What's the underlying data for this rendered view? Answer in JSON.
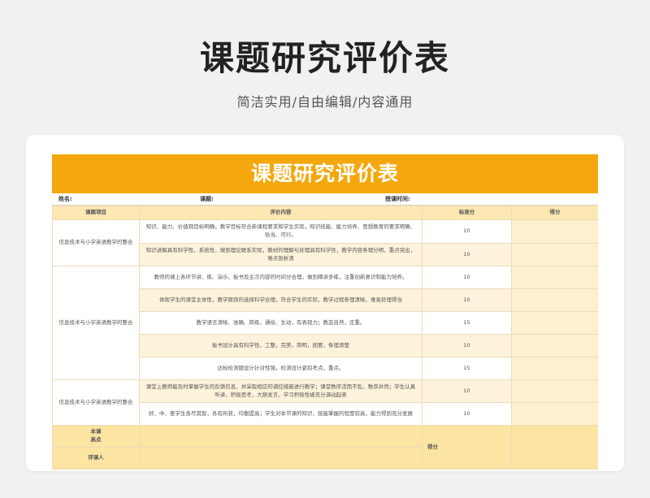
{
  "page": {
    "title": "课题研究评价表",
    "subtitle": "简洁实用/自由编辑/内容通用"
  },
  "sheet": {
    "banner": "课题研究评价表",
    "info": {
      "name_label": "姓名:",
      "topic_label": "课题:",
      "time_label": "授课时间:"
    },
    "headers": {
      "project": "课题项目",
      "content": "评价内容",
      "standard": "标准分",
      "score": "得分"
    },
    "groups": [
      {
        "project": "信息技术与小学英语教学的整合",
        "rows": [
          {
            "content": "知识、能力、价值观目标明确，教学目标符合新课程要求和学生实际，知识技能、能力培养、思想教育的要求明确、恰当、可行。",
            "standard": "10"
          },
          {
            "content": "知识讲解具有科学性，系统性，做到理论联系实际，教材的理解与处理具有科学性，教学内容条理分明，重点突出，难点剖析清",
            "standard": "10"
          }
        ]
      },
      {
        "project": "信息技术与小学英语教学的整合",
        "rows": [
          {
            "content": "教师的课上各环节讲、练、演示、板书及主次内容的时间分合理，做到精讲多练，注重创新意识和能力培养。",
            "standard": "10"
          },
          {
            "content": "体现学生的课堂主体性，教学原则的选择科学合理，符合学生的实际，教学过程条理清晰，难易处理得当",
            "standard": "10"
          },
          {
            "content": "教学语言清晰、准确、简练、通俗、生动，有表现力；教态自然，庄重。",
            "standard": "15"
          },
          {
            "content": "板书设计具有科学性，工整，完美，简明，扼要，条理清楚",
            "standard": "10"
          },
          {
            "content": "达标检测题设计针对性强，检测设计紧扣考点，重点。",
            "standard": "15"
          }
        ]
      },
      {
        "project": "信息技术与小学英语教学的整合",
        "rows": [
          {
            "content": "课堂上教师能及时掌握学生的反馈信息，并采取相应的调控措施进行教学；课堂秩序活而不乱，秩序井然；学生认真听讲，积极思考，大胆发言，学习积极性被充分调动起来",
            "standard": "10"
          },
          {
            "content": "好、中、差学生各尽其智，各有所获，均衡提高；学生对本节课的知识、技能掌握的程度较高，能力得到充分发展",
            "standard": "10"
          }
        ]
      }
    ],
    "footer": {
      "highlight_label": "本课\n高点",
      "reviewer_label": "评课人",
      "score_label": "得分"
    }
  }
}
